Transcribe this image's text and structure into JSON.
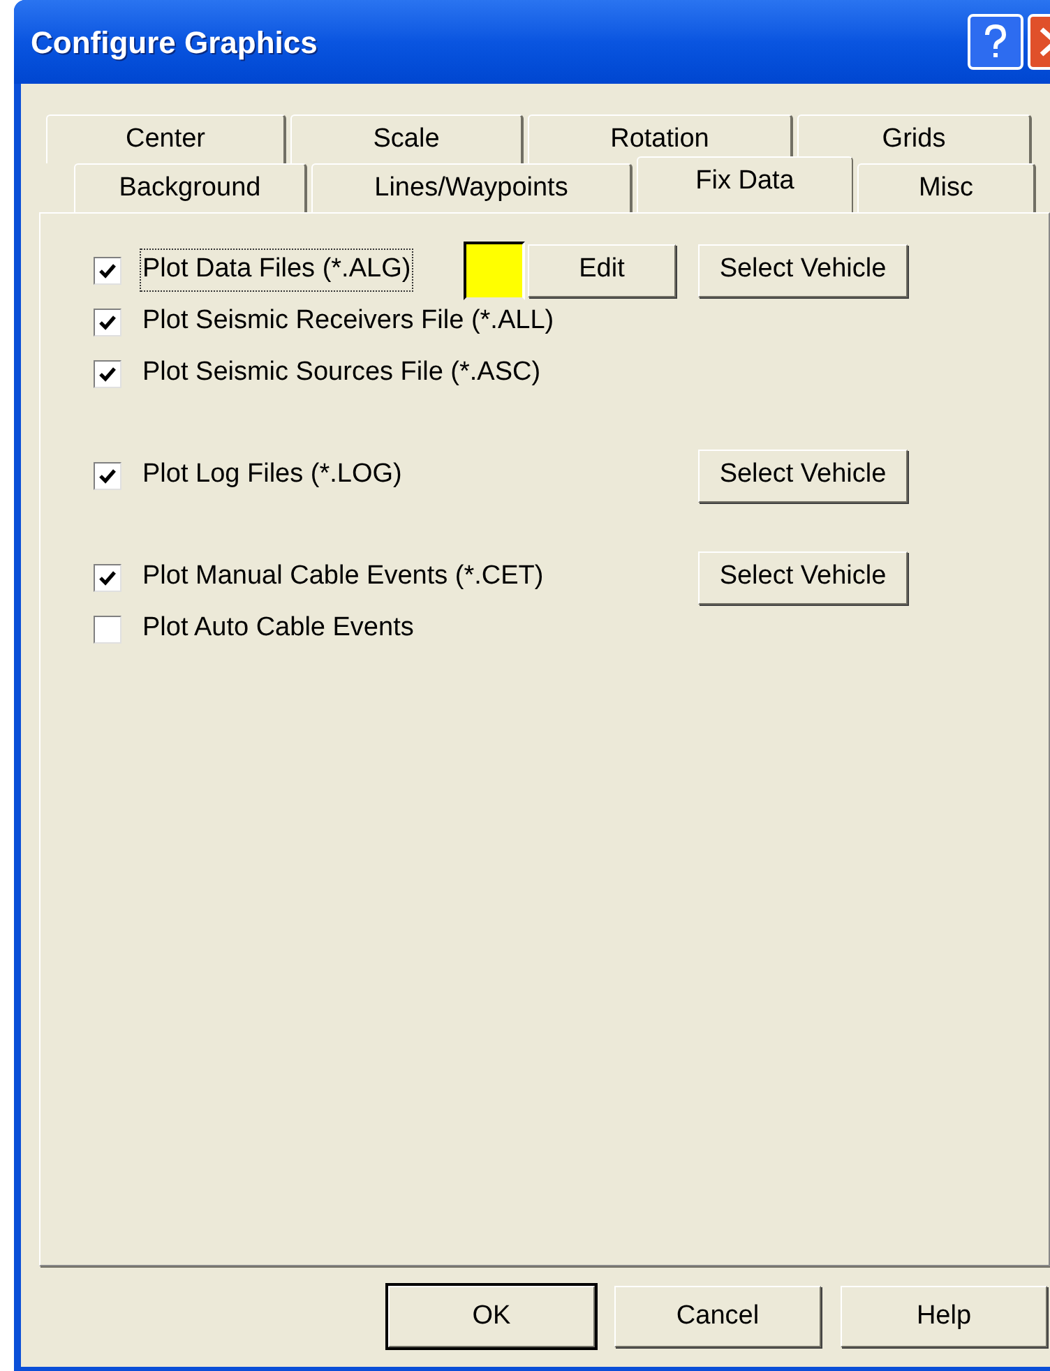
{
  "window": {
    "title": "Configure Graphics"
  },
  "tab_rows": [
    [
      {
        "label": "Center",
        "selected": false
      },
      {
        "label": "Scale",
        "selected": false
      },
      {
        "label": "Rotation",
        "selected": false
      },
      {
        "label": "Grids",
        "selected": false
      }
    ],
    [
      {
        "label": "Background",
        "selected": false
      },
      {
        "label": "Lines/Waypoints",
        "selected": false
      },
      {
        "label": "Fix Data",
        "selected": true
      },
      {
        "label": "Misc",
        "selected": false
      }
    ]
  ],
  "sections": [
    {
      "items": [
        {
          "label": "Plot Data Files (*.ALG)",
          "checked": true,
          "focused": true,
          "color": "#ffff00",
          "edit_button": "Edit",
          "vehicle_button": "Select Vehicle"
        },
        {
          "label": "Plot Seismic Receivers File (*.ALL)",
          "checked": true,
          "focused": false
        },
        {
          "label": "Plot Seismic Sources File (*.ASC)",
          "checked": true,
          "focused": false
        }
      ]
    },
    {
      "items": [
        {
          "label": "Plot Log Files (*.LOG)",
          "checked": true,
          "focused": false,
          "vehicle_button": "Select Vehicle"
        }
      ]
    },
    {
      "items": [
        {
          "label": "Plot Manual Cable Events (*.CET)",
          "checked": true,
          "focused": false,
          "vehicle_button": "Select Vehicle"
        },
        {
          "label": "Plot Auto Cable Events",
          "checked": false,
          "focused": false
        }
      ]
    }
  ],
  "buttons": [
    {
      "label": "OK",
      "default": true
    },
    {
      "label": "Cancel",
      "default": false
    },
    {
      "label": "Help",
      "default": false
    }
  ]
}
